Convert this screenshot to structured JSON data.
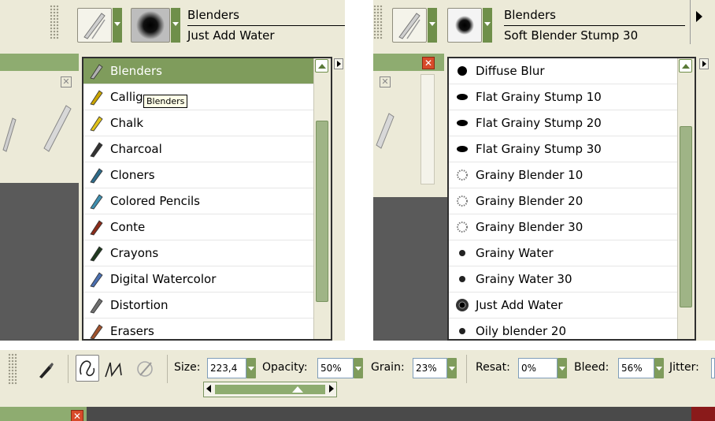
{
  "left_panel": {
    "category_title": "Blenders",
    "variant_title": "Just Add Water",
    "tooltip": "Blenders",
    "categories": [
      {
        "label": "Blenders",
        "icon": "blender-brush-icon",
        "color": "#b0b0b0",
        "selected": true
      },
      {
        "label": "Callig",
        "icon": "calligraphy-brush-icon",
        "color": "#c9a400"
      },
      {
        "label": "Chalk",
        "icon": "chalk-brush-icon",
        "color": "#e0c21a"
      },
      {
        "label": "Charcoal",
        "icon": "charcoal-brush-icon",
        "color": "#333333"
      },
      {
        "label": "Cloners",
        "icon": "cloners-brush-icon",
        "color": "#2e6b8a"
      },
      {
        "label": "Colored Pencils",
        "icon": "colored-pencils-icon",
        "color": "#3f8fb0"
      },
      {
        "label": "Conte",
        "icon": "conte-brush-icon",
        "color": "#8a2b1a"
      },
      {
        "label": "Crayons",
        "icon": "crayons-brush-icon",
        "color": "#1f3a1f"
      },
      {
        "label": "Digital Watercolor",
        "icon": "digital-watercolor-icon",
        "color": "#4a6fb0"
      },
      {
        "label": "Distortion",
        "icon": "distortion-brush-icon",
        "color": "#707070"
      },
      {
        "label": "Erasers",
        "icon": "erasers-brush-icon",
        "color": "#a0522d"
      }
    ],
    "scroll_fraction": 0.55
  },
  "right_panel": {
    "category_title": "Blenders",
    "variant_title": "Soft Blender Stump 30",
    "variants": [
      {
        "label": "Diffuse Blur",
        "icon": "dot-round-icon"
      },
      {
        "label": "Flat Grainy Stump 10",
        "icon": "dot-flat-icon"
      },
      {
        "label": "Flat Grainy Stump 20",
        "icon": "dot-flat-icon"
      },
      {
        "label": "Flat Grainy Stump 30",
        "icon": "dot-flat-icon"
      },
      {
        "label": "Grainy Blender 10",
        "icon": "dot-grainy-icon"
      },
      {
        "label": "Grainy Blender 20",
        "icon": "dot-grainy-icon"
      },
      {
        "label": "Grainy Blender 30",
        "icon": "dot-grainy-icon"
      },
      {
        "label": "Grainy Water",
        "icon": "dot-small-icon"
      },
      {
        "label": "Grainy Water 30",
        "icon": "dot-small-icon"
      },
      {
        "label": "Just Add Water",
        "icon": "dot-textured-icon"
      },
      {
        "label": "Oily blender 20",
        "icon": "dot-small-icon"
      }
    ],
    "scroll_fraction": 0.62
  },
  "property_bar": {
    "size_label": "Size:",
    "size_value": "223,4",
    "opacity_label": "Opacity:",
    "opacity_value": "50%",
    "grain_label": "Grain:",
    "grain_value": "23%",
    "resat_label": "Resat:",
    "resat_value": "0%",
    "bleed_label": "Bleed:",
    "bleed_value": "56%",
    "jitter_label": "Jitter:",
    "jitter_value": "",
    "slider_fraction": 0.78
  }
}
